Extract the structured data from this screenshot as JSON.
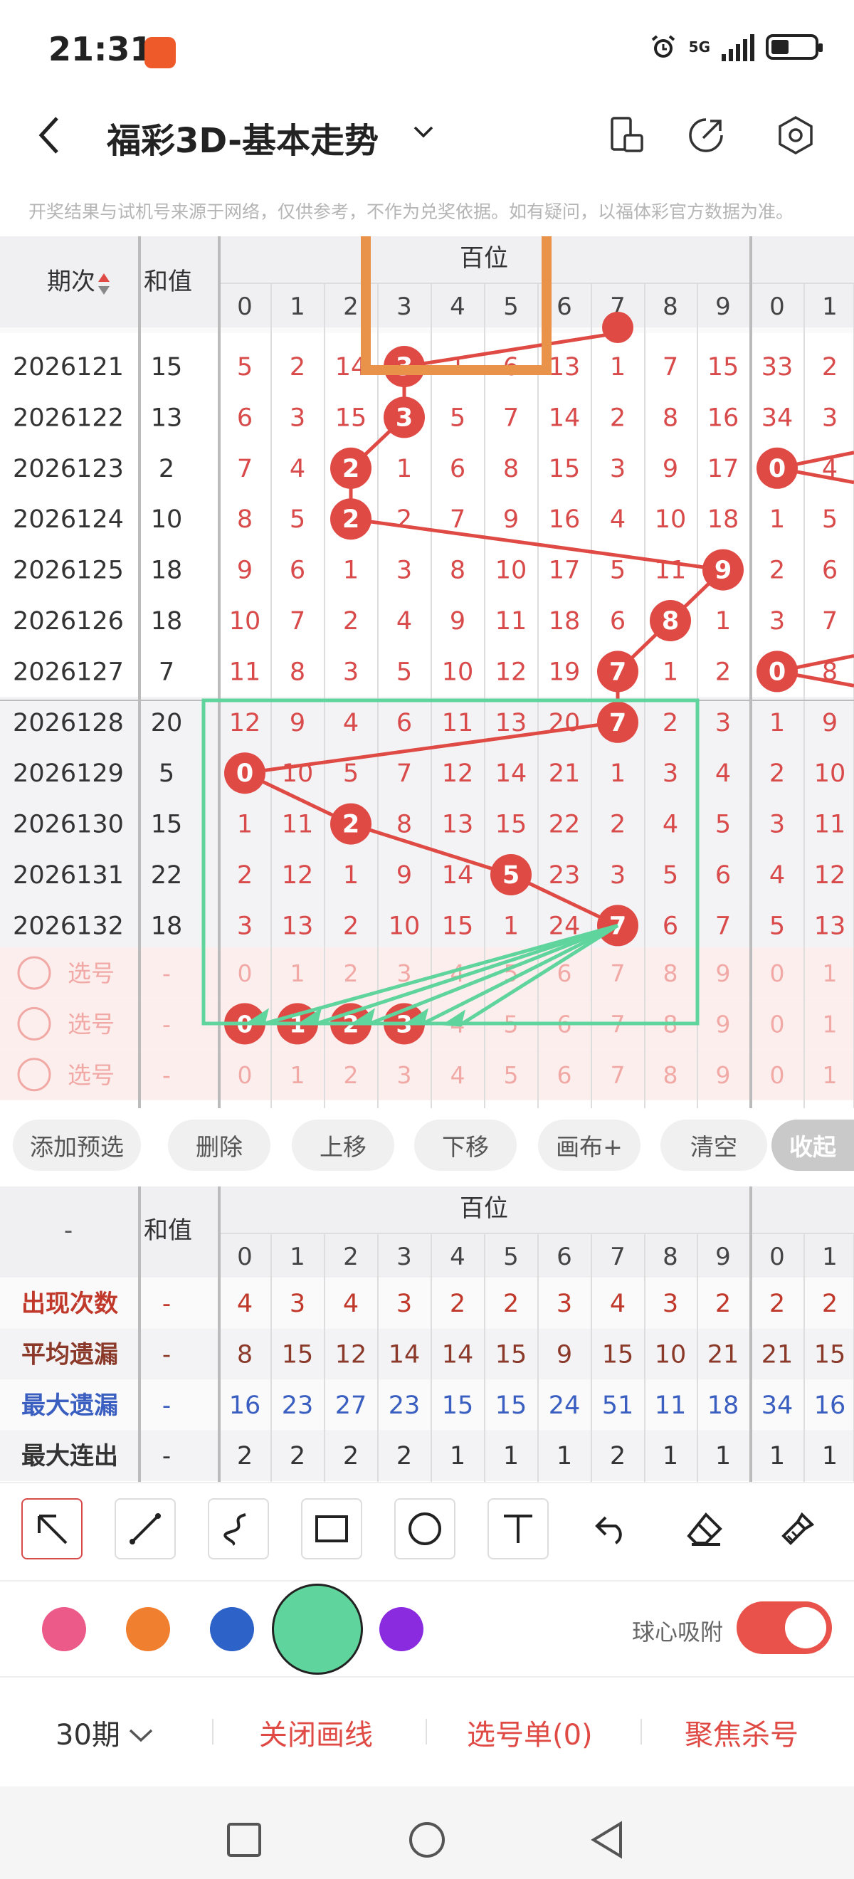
{
  "status": {
    "time": "21:31",
    "network": "5G"
  },
  "header": {
    "title": "福彩3D-基本走势"
  },
  "notice": "开奖结果与试机号来源于网络，仅供参考，不作为兑奖依据。如有疑问，以福体彩官方数据为准。",
  "table": {
    "col_period": "期次",
    "col_sum": "和值",
    "group_label": "百位",
    "digits": [
      "0",
      "1",
      "2",
      "3",
      "4",
      "5",
      "6",
      "7",
      "8",
      "9",
      "0",
      "1"
    ],
    "rows": [
      {
        "period": "2026121",
        "sum": "15",
        "cells": [
          "5",
          "2",
          "14",
          "3",
          "1",
          "6",
          "13",
          "1",
          "7",
          "15",
          "33",
          "2"
        ],
        "hit": 3
      },
      {
        "period": "2026122",
        "sum": "13",
        "cells": [
          "6",
          "3",
          "15",
          "3",
          "5",
          "7",
          "14",
          "2",
          "8",
          "16",
          "34",
          "3"
        ],
        "hit": 3
      },
      {
        "period": "2026123",
        "sum": "2",
        "cells": [
          "7",
          "4",
          "2",
          "1",
          "6",
          "8",
          "15",
          "3",
          "9",
          "17",
          "0",
          "4"
        ],
        "hit": 2
      },
      {
        "period": "2026124",
        "sum": "10",
        "cells": [
          "8",
          "5",
          "2",
          "2",
          "7",
          "9",
          "16",
          "4",
          "10",
          "18",
          "1",
          "5"
        ],
        "hit": 2
      },
      {
        "period": "2026125",
        "sum": "18",
        "cells": [
          "9",
          "6",
          "1",
          "3",
          "8",
          "10",
          "17",
          "5",
          "11",
          "9",
          "2",
          "6"
        ],
        "hit": 9
      },
      {
        "period": "2026126",
        "sum": "18",
        "cells": [
          "10",
          "7",
          "2",
          "4",
          "9",
          "11",
          "18",
          "6",
          "8",
          "1",
          "3",
          "7"
        ],
        "hit": 8
      },
      {
        "period": "2026127",
        "sum": "7",
        "cells": [
          "11",
          "8",
          "3",
          "5",
          "10",
          "12",
          "19",
          "7",
          "1",
          "2",
          "0",
          "8"
        ],
        "hit": 7
      },
      {
        "period": "2026128",
        "sum": "20",
        "cells": [
          "12",
          "9",
          "4",
          "6",
          "11",
          "13",
          "20",
          "7",
          "2",
          "3",
          "1",
          "9"
        ],
        "hit": 7
      },
      {
        "period": "2026129",
        "sum": "5",
        "cells": [
          "0",
          "10",
          "5",
          "7",
          "12",
          "14",
          "21",
          "1",
          "3",
          "4",
          "2",
          "10"
        ],
        "hit": 0
      },
      {
        "period": "2026130",
        "sum": "15",
        "cells": [
          "1",
          "11",
          "2",
          "8",
          "13",
          "15",
          "22",
          "2",
          "4",
          "5",
          "3",
          "11"
        ],
        "hit": 2
      },
      {
        "period": "2026131",
        "sum": "22",
        "cells": [
          "2",
          "12",
          "1",
          "9",
          "14",
          "5",
          "23",
          "3",
          "5",
          "6",
          "4",
          "12"
        ],
        "hit": 5
      },
      {
        "period": "2026132",
        "sum": "18",
        "cells": [
          "3",
          "13",
          "2",
          "10",
          "15",
          "1",
          "24",
          "7",
          "6",
          "7",
          "5",
          "13"
        ],
        "hit": 7
      }
    ],
    "pick_label": "选号",
    "pick_sum": "-"
  },
  "actions": [
    "添加预选",
    "删除",
    "上移",
    "下移",
    "画布+",
    "清空",
    "收起"
  ],
  "stats": {
    "corner": "-",
    "col_sum": "和值",
    "group_label": "百位",
    "rows": [
      {
        "label": "出现次数",
        "sum": "-",
        "values": [
          "4",
          "3",
          "4",
          "3",
          "2",
          "2",
          "3",
          "4",
          "3",
          "2",
          "2",
          "2"
        ],
        "color": "#c0392b"
      },
      {
        "label": "平均遗漏",
        "sum": "-",
        "values": [
          "8",
          "15",
          "12",
          "14",
          "14",
          "15",
          "9",
          "15",
          "10",
          "21",
          "21",
          "15"
        ],
        "color": "#8b3a2a"
      },
      {
        "label": "最大遗漏",
        "sum": "-",
        "values": [
          "16",
          "23",
          "27",
          "23",
          "15",
          "15",
          "24",
          "51",
          "11",
          "18",
          "34",
          "16"
        ],
        "color": "#3a5fc0"
      },
      {
        "label": "最大连出",
        "sum": "-",
        "values": [
          "2",
          "2",
          "2",
          "2",
          "1",
          "1",
          "1",
          "2",
          "1",
          "1",
          "1",
          "1"
        ],
        "color": "#333"
      }
    ]
  },
  "toolbar": {
    "tools": [
      "arrow-tool-icon",
      "line-tool-icon",
      "curve-tool-icon",
      "rect-tool-icon",
      "circle-tool-icon",
      "text-tool-icon",
      "undo-icon",
      "eraser-icon",
      "clear-brush-icon"
    ]
  },
  "palette": {
    "colors": [
      "#ec5a8a",
      "#f08030",
      "#2d62c8",
      "#5fd49c",
      "#8b2be0"
    ],
    "selected": 3,
    "snap_label": "球心吸附",
    "snap_on": true
  },
  "bottom": {
    "periods": "30期",
    "close_lines": "关闭画线",
    "pick_list": "选号单(0)",
    "focus_kill": "聚焦杀号"
  },
  "colors": {
    "accent": "#e04a45",
    "ball": "#e04a45",
    "grid_red": "#d94b4b",
    "highlight_orange": "#e8924a",
    "highlight_green": "#5fd49c"
  }
}
